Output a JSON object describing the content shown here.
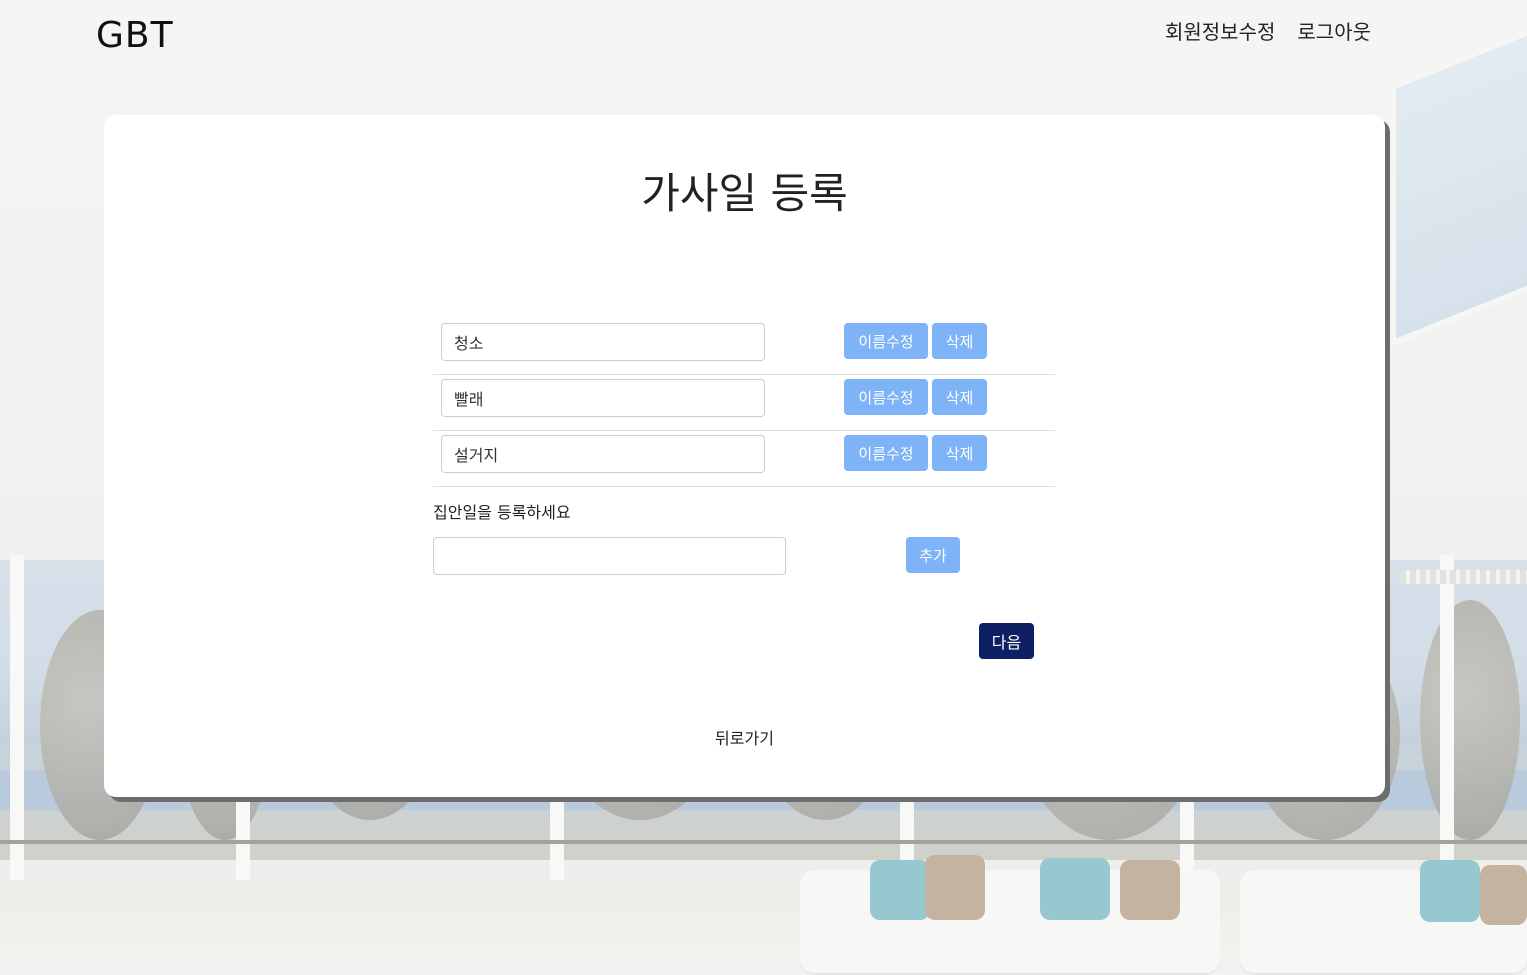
{
  "header": {
    "brand": "GBT",
    "nav": [
      {
        "label": "회원정보수정"
      },
      {
        "label": "로그아웃"
      }
    ]
  },
  "page": {
    "title": "가사일 등록"
  },
  "chores": [
    {
      "name": "청소",
      "rename_label": "이름수정",
      "delete_label": "삭제"
    },
    {
      "name": "빨래",
      "rename_label": "이름수정",
      "delete_label": "삭제"
    },
    {
      "name": "설거지",
      "rename_label": "이름수정",
      "delete_label": "삭제"
    }
  ],
  "add": {
    "label": "집안일을 등록하세요",
    "value": "",
    "button_label": "추가"
  },
  "next_label": "다음",
  "back_label": "뒤로가기",
  "colors": {
    "light_button": "#7fb3f7",
    "primary_button": "#0e1f63",
    "card_shadow": "#6d6d6d"
  }
}
